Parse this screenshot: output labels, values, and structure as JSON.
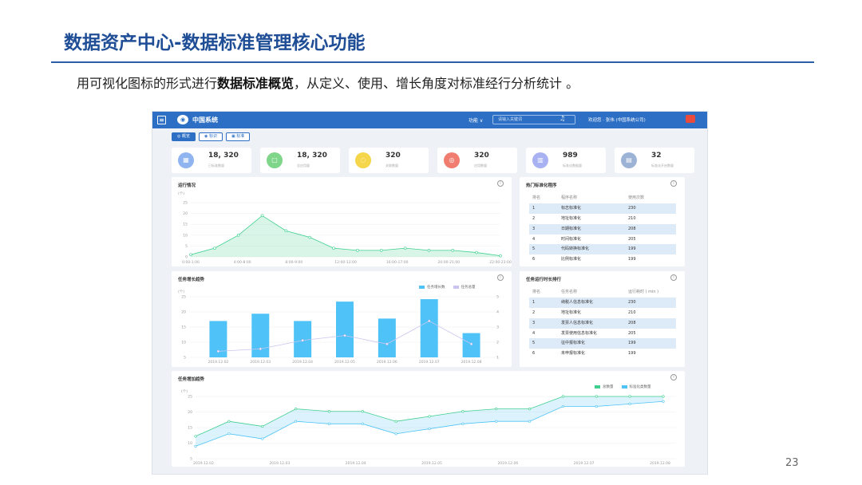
{
  "slide": {
    "title": "数据资产中心-数据标准管理核心功能",
    "subtitle_pre": "用可视化图标的形式进行",
    "subtitle_bold": "数据标准概览",
    "subtitle_post": "，从定义、使用、增长角度对标准经行分析统计 。",
    "page_number": "23"
  },
  "app": {
    "brand": "中国系统",
    "func_label": "功能 ∨",
    "search_placeholder": "请输入关键词",
    "account": "欢迎您 · 张伟 (中国系统公司)",
    "menu_icon": "≡",
    "logo_icon": "◉",
    "bell_icon": "♫"
  },
  "tabs": [
    {
      "label": "概览",
      "icon": "◎",
      "active": true
    },
    {
      "label": "标识",
      "icon": "◉",
      "active": false
    },
    {
      "label": "标准",
      "icon": "▣",
      "active": false
    }
  ],
  "stats": [
    {
      "num": "18, 320",
      "label": "已标准数量",
      "color": "#8fb4f0",
      "icon": "▦"
    },
    {
      "num": "18, 320",
      "label": "总应用量",
      "color": "#7fd68a",
      "icon": "▢"
    },
    {
      "num": "320",
      "label": "关联数量",
      "color": "#f5d64a",
      "icon": "◌"
    },
    {
      "num": "320",
      "label": "应用数量",
      "color": "#f07d6f",
      "icon": "◎"
    },
    {
      "num": "989",
      "label": "标准化数据量",
      "color": "#a8b2f2",
      "icon": "▥"
    },
    {
      "num": "32",
      "label": "标准化开启数量",
      "color": "#9db3d6",
      "icon": "▤"
    }
  ],
  "panels": {
    "run": {
      "title": "运行情况"
    },
    "hot": {
      "title": "热门标准化程序"
    },
    "growth": {
      "title": "任务增长趋势"
    },
    "duration": {
      "title": "任务运行时长排行"
    },
    "trend": {
      "title": "任务增加趋势"
    }
  },
  "hot_table": {
    "headers": [
      "排名",
      "程序名称",
      "使用次数"
    ],
    "rows": [
      [
        "1",
        "标志标准化",
        "230"
      ],
      [
        "2",
        "地址标准化",
        "210"
      ],
      [
        "3",
        "日期标准化",
        "208"
      ],
      [
        "4",
        "时间标准化",
        "205"
      ],
      [
        "5",
        "代码转换标准化",
        "199"
      ],
      [
        "6",
        "比例标准化",
        "199"
      ]
    ]
  },
  "duration_table": {
    "headers": [
      "排名",
      "任务名称",
      "运行耗时 ( min )"
    ],
    "rows": [
      [
        "1",
        "纳税人信息标准化",
        "230"
      ],
      [
        "2",
        "地址标准化",
        "210"
      ],
      [
        "3",
        "发票人信息标准化",
        "208"
      ],
      [
        "4",
        "发票使用信息标准化",
        "205"
      ],
      [
        "5",
        "征中报标准化",
        "199"
      ],
      [
        "6",
        "未申报标准化",
        "199"
      ]
    ]
  },
  "chart_data": [
    {
      "type": "area",
      "ylabel": "(个)",
      "ylim": [
        0,
        25
      ],
      "yticks": [
        "25",
        "20",
        "15",
        "10",
        "5",
        "0"
      ],
      "categories": [
        "0:00-1:00",
        "4:00-8:00",
        "8:00-9:00",
        "12:00-13:00",
        "16:00-17:00",
        "20:00-21:00",
        "22:00-23:00"
      ],
      "x": [
        0,
        1,
        2,
        3,
        4,
        5,
        6,
        7,
        8,
        9,
        10,
        11,
        12,
        13
      ],
      "values": [
        1,
        4,
        10,
        19,
        12,
        9,
        4,
        3,
        3,
        4,
        3,
        3,
        2,
        0.5
      ],
      "color": "#3ecf8e"
    },
    {
      "type": "bar",
      "ylabel": "(个)",
      "ylim": [
        0,
        25
      ],
      "yticks": [
        "25",
        "20",
        "15",
        "10",
        "5"
      ],
      "y2ticks": [
        "5",
        "4",
        "3",
        "2",
        "1"
      ],
      "categories": [
        "2019.12.02",
        "2019.12.03",
        "2019.12.04",
        "2019.12.05",
        "2019.12.06",
        "2019.12.07",
        "2019.12.08"
      ],
      "series": [
        {
          "name": "任务增长数",
          "values": [
            15,
            18,
            15,
            23,
            16,
            24,
            10
          ],
          "color": "#4fc3f7"
        },
        {
          "name": "任务总量",
          "values": [
            0.5,
            0.7,
            1.4,
            1.8,
            1.1,
            3.0,
            1.1
          ],
          "color": "#c9c4ef"
        }
      ]
    },
    {
      "type": "area",
      "ylabel": "(个)",
      "ylim": [
        0,
        25
      ],
      "yticks": [
        "25",
        "20",
        "15",
        "10",
        "5"
      ],
      "categories": [
        "2019.12.02",
        "2019.12.03",
        "2019.12.04",
        "2019.12.05",
        "2019.12.06",
        "2019.12.07",
        "2019.12.08"
      ],
      "series": [
        {
          "name": "总数量",
          "values": [
            9,
            15,
            13,
            20,
            19,
            19,
            15,
            17,
            19,
            20,
            20,
            26,
            26,
            27,
            28
          ],
          "color": "#3ecf8e"
        },
        {
          "name": "标准化类数量",
          "values": [
            5,
            10,
            8,
            15,
            14,
            14,
            10,
            12,
            14,
            15,
            15,
            21,
            21,
            22,
            23
          ],
          "color": "#4fc3f7"
        }
      ]
    }
  ]
}
